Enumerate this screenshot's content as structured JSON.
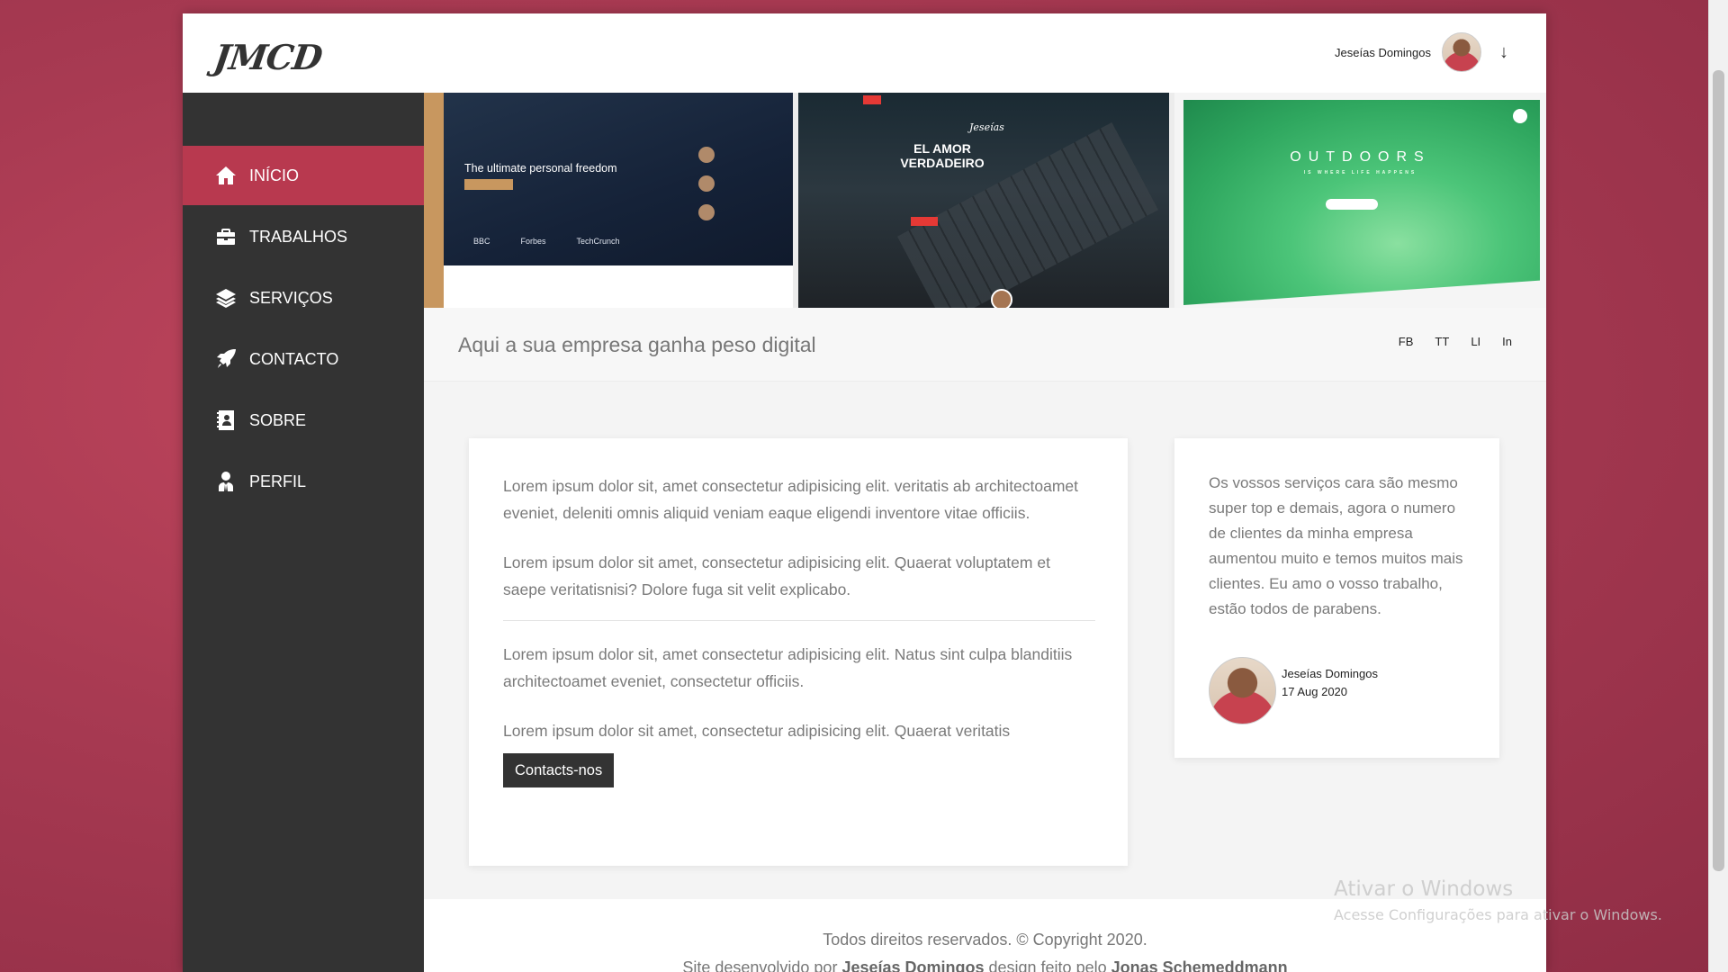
{
  "header": {
    "logo": "JMCD",
    "user_name": "Jeseías Domingos",
    "dropdown_arrow": "↓"
  },
  "sidebar": {
    "items": [
      {
        "label": "INÍCIO",
        "icon": "home-icon",
        "active": true
      },
      {
        "label": "TRABALHOS",
        "icon": "briefcase-icon",
        "active": false
      },
      {
        "label": "SERVIÇOS",
        "icon": "layers-icon",
        "active": false
      },
      {
        "label": "CONTACTO",
        "icon": "rocket-icon",
        "active": false
      },
      {
        "label": "SOBRE",
        "icon": "contact-book-icon",
        "active": false
      },
      {
        "label": "PERFIL",
        "icon": "user-tie-icon",
        "active": false
      }
    ]
  },
  "banner": {
    "shot1": {
      "headline": "The ultimate personal freedom",
      "brands": [
        "BBC",
        "Forbes",
        "TechCrunch"
      ]
    },
    "shot2": {
      "title": "EL AMOR VERDADEIRO",
      "brand": "Jeseías"
    },
    "shot3": {
      "title": "OUTDOORS",
      "subtitle": "IS WHERE LIFE HAPPENS"
    }
  },
  "strap": {
    "tagline": "Aqui a sua empresa ganha peso digital",
    "social": [
      "FB",
      "TT",
      "LI",
      "In"
    ]
  },
  "content": {
    "paragraphs_top": [
      "Lorem ipsum dolor sit, amet consectetur adipisicing elit. veritatis ab architectoamet eveniet, deleniti omnis aliquid veniam eaque eligendi inventore vitae officiis.",
      "Lorem ipsum dolor sit amet, consectetur adipisicing elit. Quaerat voluptatem et saepe veritatisnisi? Dolore fuga sit velit explicabo."
    ],
    "paragraphs_bottom": [
      "Lorem ipsum dolor sit, amet consectetur adipisicing elit. Natus sint culpa blanditiis architectoamet eveniet, consectetur officiis.",
      "Lorem ipsum dolor sit amet, consectetur adipisicing elit. Quaerat veritatis"
    ],
    "button_label": "Contacts-nos"
  },
  "testimonial": {
    "quote": "Os vossos serviços cara são mesmo super top e demais, agora o numero de clientes da minha empresa aumentou muito e temos muitos mais clientes. Eu amo o vosso trabalho, estão todos de parabens.",
    "author": "Jeseías Domingos",
    "date": "17 Aug 2020"
  },
  "footer": {
    "line1": "Todos direitos reservados. © Copyright 2020.",
    "line2_prefix": "Site desenvolvido por ",
    "developer": "Jeseías Domingos",
    "line2_middle": " design feito pelo ",
    "designer": "Jonas Schemeddmann"
  },
  "watermark": {
    "title": "Ativar o Windows",
    "subtitle": "Acesse Configurações para ativar o Windows."
  },
  "colors": {
    "accent": "#b8394f",
    "sidebar": "#333333",
    "background": "#a83a52"
  }
}
